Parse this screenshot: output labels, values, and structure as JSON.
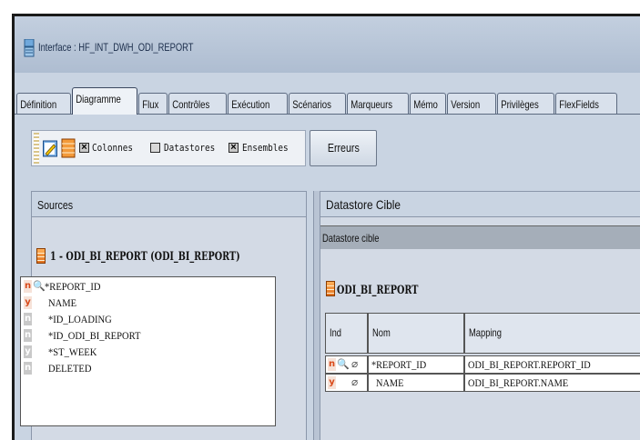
{
  "window": {
    "title": "Interface : HF_INT_DWH_ODI_REPORT"
  },
  "tabs": [
    {
      "label": "Définition"
    },
    {
      "label": "Diagramme"
    },
    {
      "label": "Flux"
    },
    {
      "label": "Contrôles"
    },
    {
      "label": "Exécution"
    },
    {
      "label": "Scénarios"
    },
    {
      "label": "Marqueurs"
    },
    {
      "label": "Mémo"
    },
    {
      "label": "Version"
    },
    {
      "label": "Privilèges"
    },
    {
      "label": "FlexFields"
    }
  ],
  "active_tab": "Diagramme",
  "toolbar": {
    "colonnes_label": "Colonnes",
    "colonnes_checked": true,
    "datastores_label": "Datastores",
    "datastores_checked": false,
    "ensembles_label": "Ensembles",
    "ensembles_checked": true,
    "erreurs_label": "Erreurs"
  },
  "sources": {
    "header": "Sources",
    "datastore_title": "1 - ODI_BI_REPORT (ODI_BI_REPORT)",
    "columns": [
      {
        "flag": "n",
        "key": true,
        "name": "*REPORT_ID"
      },
      {
        "flag": "y",
        "key": false,
        "name": "NAME"
      },
      {
        "flag": "n",
        "key": false,
        "name": "*ID_LOADING"
      },
      {
        "flag": "n",
        "key": false,
        "name": "*ID_ODI_BI_REPORT"
      },
      {
        "flag": "y",
        "key": false,
        "name": "*ST_WEEK"
      },
      {
        "flag": "n",
        "key": false,
        "name": "DELETED"
      }
    ]
  },
  "target": {
    "header": "Datastore Cible",
    "subheader": "Datastore cible",
    "datastore_title": "ODI_BI_REPORT",
    "columns_header": {
      "ind": "Ind",
      "nom": "Nom",
      "mapping": "Mapping"
    },
    "rows": [
      {
        "flag": "n",
        "nom": "*REPORT_ID",
        "mapping": "ODI_BI_REPORT.REPORT_ID"
      },
      {
        "flag": "y",
        "nom": "NAME",
        "mapping": "ODI_BI_REPORT.NAME"
      }
    ]
  }
}
